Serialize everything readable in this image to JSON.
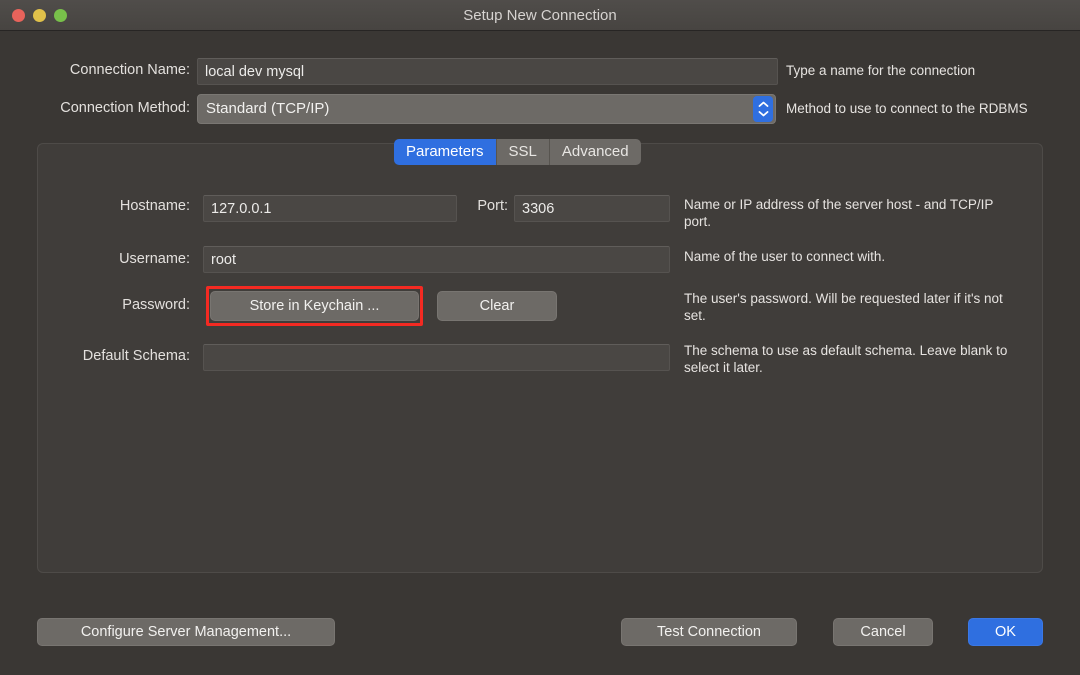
{
  "window": {
    "title": "Setup New Connection",
    "traffic_lights": [
      "close-red",
      "minimize-yellow",
      "zoom-green"
    ]
  },
  "form": {
    "connection_name": {
      "label": "Connection Name:",
      "value": "local dev mysql",
      "help": "Type a name for the connection"
    },
    "connection_method": {
      "label": "Connection Method:",
      "value": "Standard (TCP/IP)",
      "help": "Method to use to connect to the RDBMS"
    }
  },
  "tabs": [
    {
      "label": "Parameters",
      "active": true
    },
    {
      "label": "SSL",
      "active": false
    },
    {
      "label": "Advanced",
      "active": false
    }
  ],
  "parameters": {
    "hostname": {
      "label": "Hostname:",
      "value": "127.0.0.1"
    },
    "port": {
      "label": "Port:",
      "value": "3306",
      "help": "Name or IP address of the server host - and TCP/IP port."
    },
    "username": {
      "label": "Username:",
      "value": "root",
      "help": "Name of the user to connect with."
    },
    "password": {
      "label": "Password:",
      "store_button": "Store in Keychain ...",
      "clear_button": "Clear",
      "help": "The user's password. Will be requested later if it's not set."
    },
    "default_schema": {
      "label": "Default Schema:",
      "value": "",
      "placeholder": "",
      "help": "The schema to use as default schema. Leave blank to select it later."
    }
  },
  "footer": {
    "configure_server_management": "Configure Server Management...",
    "test_connection": "Test Connection",
    "cancel": "Cancel",
    "ok": "OK"
  },
  "colors": {
    "accent_blue": "#2f6fe0",
    "annotation_red": "#f42a22",
    "window_bg": "#3a3734",
    "panel_bg": "#403d3a"
  }
}
